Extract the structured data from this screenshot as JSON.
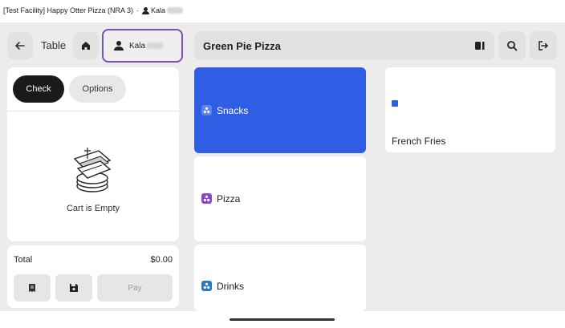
{
  "titlebar": {
    "facility": "[Test Facility] Happy Otter Pizza (NRA 3)",
    "separator": "-",
    "user": "Kala"
  },
  "topbar": {
    "table_label": "Table",
    "user_name": "Kala",
    "store_title": "Green Pie Pizza"
  },
  "cart": {
    "tabs": [
      {
        "label": "Check",
        "active": true
      },
      {
        "label": "Options",
        "active": false
      }
    ],
    "empty_message": "Cart is Empty",
    "total_label": "Total",
    "total_value": "$0.00",
    "pay_label": "Pay"
  },
  "categories": [
    {
      "label": "Snacks",
      "selected": true,
      "color": "#2f5ee5"
    },
    {
      "label": "Pizza",
      "selected": false,
      "color": "#8b44d6"
    },
    {
      "label": "Drinks",
      "selected": false,
      "color": "#2c78bf"
    }
  ],
  "items": [
    {
      "name": "French Fries",
      "color": "#2f5ee5"
    }
  ],
  "icons": {
    "back": "arrow-left-icon",
    "home": "home-icon",
    "user": "user-icon",
    "barcode": "barcode-icon",
    "search": "search-icon",
    "logout": "logout-icon",
    "receipt": "receipt-icon",
    "save": "save-icon",
    "category": "category-icon"
  }
}
